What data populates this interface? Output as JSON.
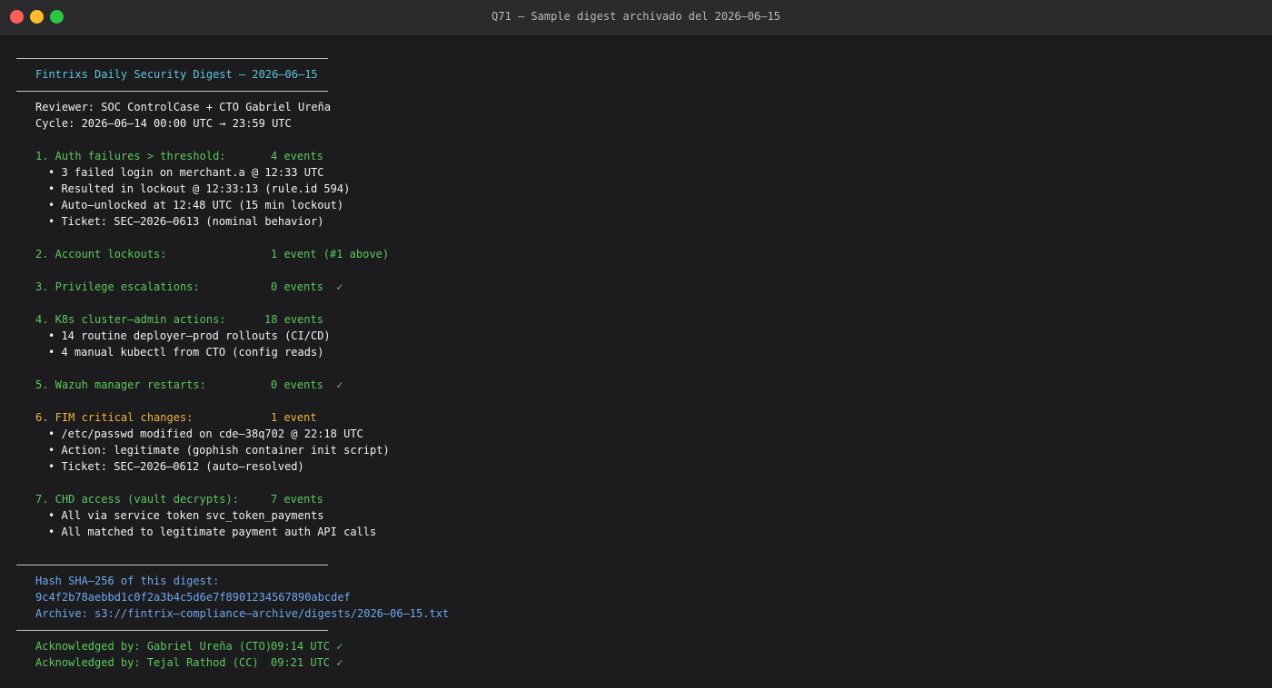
{
  "window": {
    "title": "Q71 — Sample digest archivado del 2026–06–15"
  },
  "digest": {
    "header": "Fintrixs Daily Security Digest — 2026–06–15",
    "reviewer": "Reviewer: SOC ControlCase + CTO Gabriel Ureña",
    "cycle": "Cycle: 2026–06–14 00:00 UTC → 23:59 UTC",
    "sections": [
      {
        "label": "1. Auth failures > threshold:",
        "value": "4 events",
        "bullets": [
          "• 3 failed login on merchant.a @ 12:33 UTC",
          "• Resulted in lockout @ 12:33:13 (rule.id 594)",
          "• Auto–unlocked at 12:48 UTC (15 min lockout)",
          "• Ticket: SEC–2026–0613 (nominal behavior)"
        ]
      },
      {
        "label": "2. Account lockouts:",
        "value": "1 event (#1 above)",
        "bullets": []
      },
      {
        "label": "3. Privilege escalations:",
        "value": "0 events  ✓",
        "bullets": []
      },
      {
        "label": "4. K8s cluster–admin actions:",
        "value": "18 events",
        "bullets": [
          "• 14 routine deployer–prod rollouts (CI/CD)",
          "• 4 manual kubectl from CTO (config reads)"
        ]
      },
      {
        "label": "5. Wazuh manager restarts:",
        "value": "0 events  ✓",
        "bullets": []
      },
      {
        "label": "6. FIM critical changes:",
        "value": "1 event",
        "bullets": [
          "• /etc/passwd modified on cde–38q702 @ 22:18 UTC",
          "• Action: legitimate (gophish container init script)",
          "• Ticket: SEC–2026–0612 (auto–resolved)"
        ]
      },
      {
        "label": "7. CHD access (vault decrypts):",
        "value": "7 events",
        "bullets": [
          "• All via service token svc_token_payments",
          "• All matched to legitimate payment auth API calls"
        ]
      }
    ],
    "hash_label": "Hash SHA–256 of this digest:",
    "hash_value": "9c4f2b78aebbd1c0f2a3b4c5d6e7f8901234567890abcdef",
    "archive": "Archive: s3://fintrix–compliance–archive/digests/2026–06–15.txt",
    "acks": [
      {
        "name": "Acknowledged by: Gabriel Ureña (CTO)",
        "time": "09:14 UTC ✓"
      },
      {
        "name": "Acknowledged by: Tejal Rathod (CC)",
        "time": "09:21 UTC ✓"
      }
    ]
  }
}
